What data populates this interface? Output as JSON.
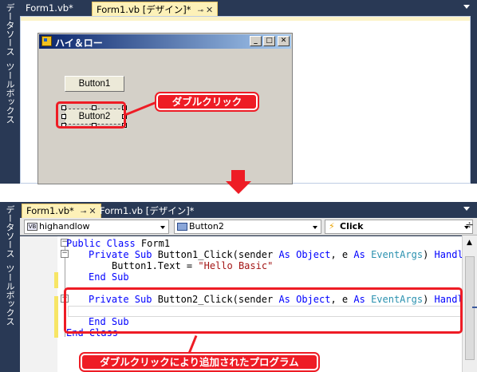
{
  "top_panel": {
    "side_tabs": [
      "データソース",
      "ツールボックス"
    ],
    "tabs": [
      {
        "label": "Form1.vb*",
        "active": false
      },
      {
        "label": "Form1.vb [デザイン]*",
        "active": true,
        "pin": "⊸",
        "close": "✕"
      }
    ],
    "form": {
      "title": "ハイ＆ロー",
      "buttons": [
        "Button1",
        "Button2"
      ],
      "window_controls": [
        "_",
        "□",
        "✕"
      ]
    },
    "callout": "ダブルクリック"
  },
  "bottom_panel": {
    "side_tabs": [
      "データソース",
      "ツールボックス"
    ],
    "tabs": [
      {
        "label": "Form1.vb*",
        "active": true,
        "pin": "⊸",
        "close": "✕"
      },
      {
        "label": "Form1.vb [デザイン]*",
        "active": false
      }
    ],
    "combos": {
      "class_name": "highandlow",
      "class_icon": "VB",
      "object_name": "Button2",
      "event_name": "Click"
    },
    "code_lines": [
      {
        "indent": 0,
        "parts": [
          [
            "kw",
            "Public Class"
          ],
          [
            "txt",
            " Form1"
          ]
        ]
      },
      {
        "indent": 1,
        "parts": [
          [
            "kw",
            "Private Sub"
          ],
          [
            "txt",
            " Button1_Click(sender "
          ],
          [
            "kw",
            "As Object"
          ],
          [
            "txt",
            ", e "
          ],
          [
            "kw",
            "As"
          ],
          [
            "txt",
            " "
          ],
          [
            "ty",
            "EventArgs"
          ],
          [
            "txt",
            ") "
          ],
          [
            "kw",
            "Handles"
          ]
        ]
      },
      {
        "indent": 2,
        "parts": [
          [
            "txt",
            "Button1.Text = "
          ],
          [
            "str",
            "\"Hello Basic\""
          ]
        ]
      },
      {
        "indent": 1,
        "parts": [
          [
            "kw",
            "End Sub"
          ]
        ]
      },
      {
        "indent": 0,
        "parts": []
      },
      {
        "indent": 1,
        "parts": [
          [
            "kw",
            "Private Sub"
          ],
          [
            "txt",
            " Button2_Click(sender "
          ],
          [
            "kw",
            "As Object"
          ],
          [
            "txt",
            ", e "
          ],
          [
            "kw",
            "As"
          ],
          [
            "txt",
            " "
          ],
          [
            "ty",
            "EventArgs"
          ],
          [
            "txt",
            ") "
          ],
          [
            "kw",
            "Handles"
          ]
        ]
      },
      {
        "indent": 0,
        "parts": []
      },
      {
        "indent": 1,
        "parts": [
          [
            "kw",
            "End Sub"
          ]
        ]
      },
      {
        "indent": 0,
        "parts": [
          [
            "kw",
            "End Class"
          ]
        ]
      }
    ],
    "callout": "ダブルクリックにより追加されたプログラム"
  }
}
